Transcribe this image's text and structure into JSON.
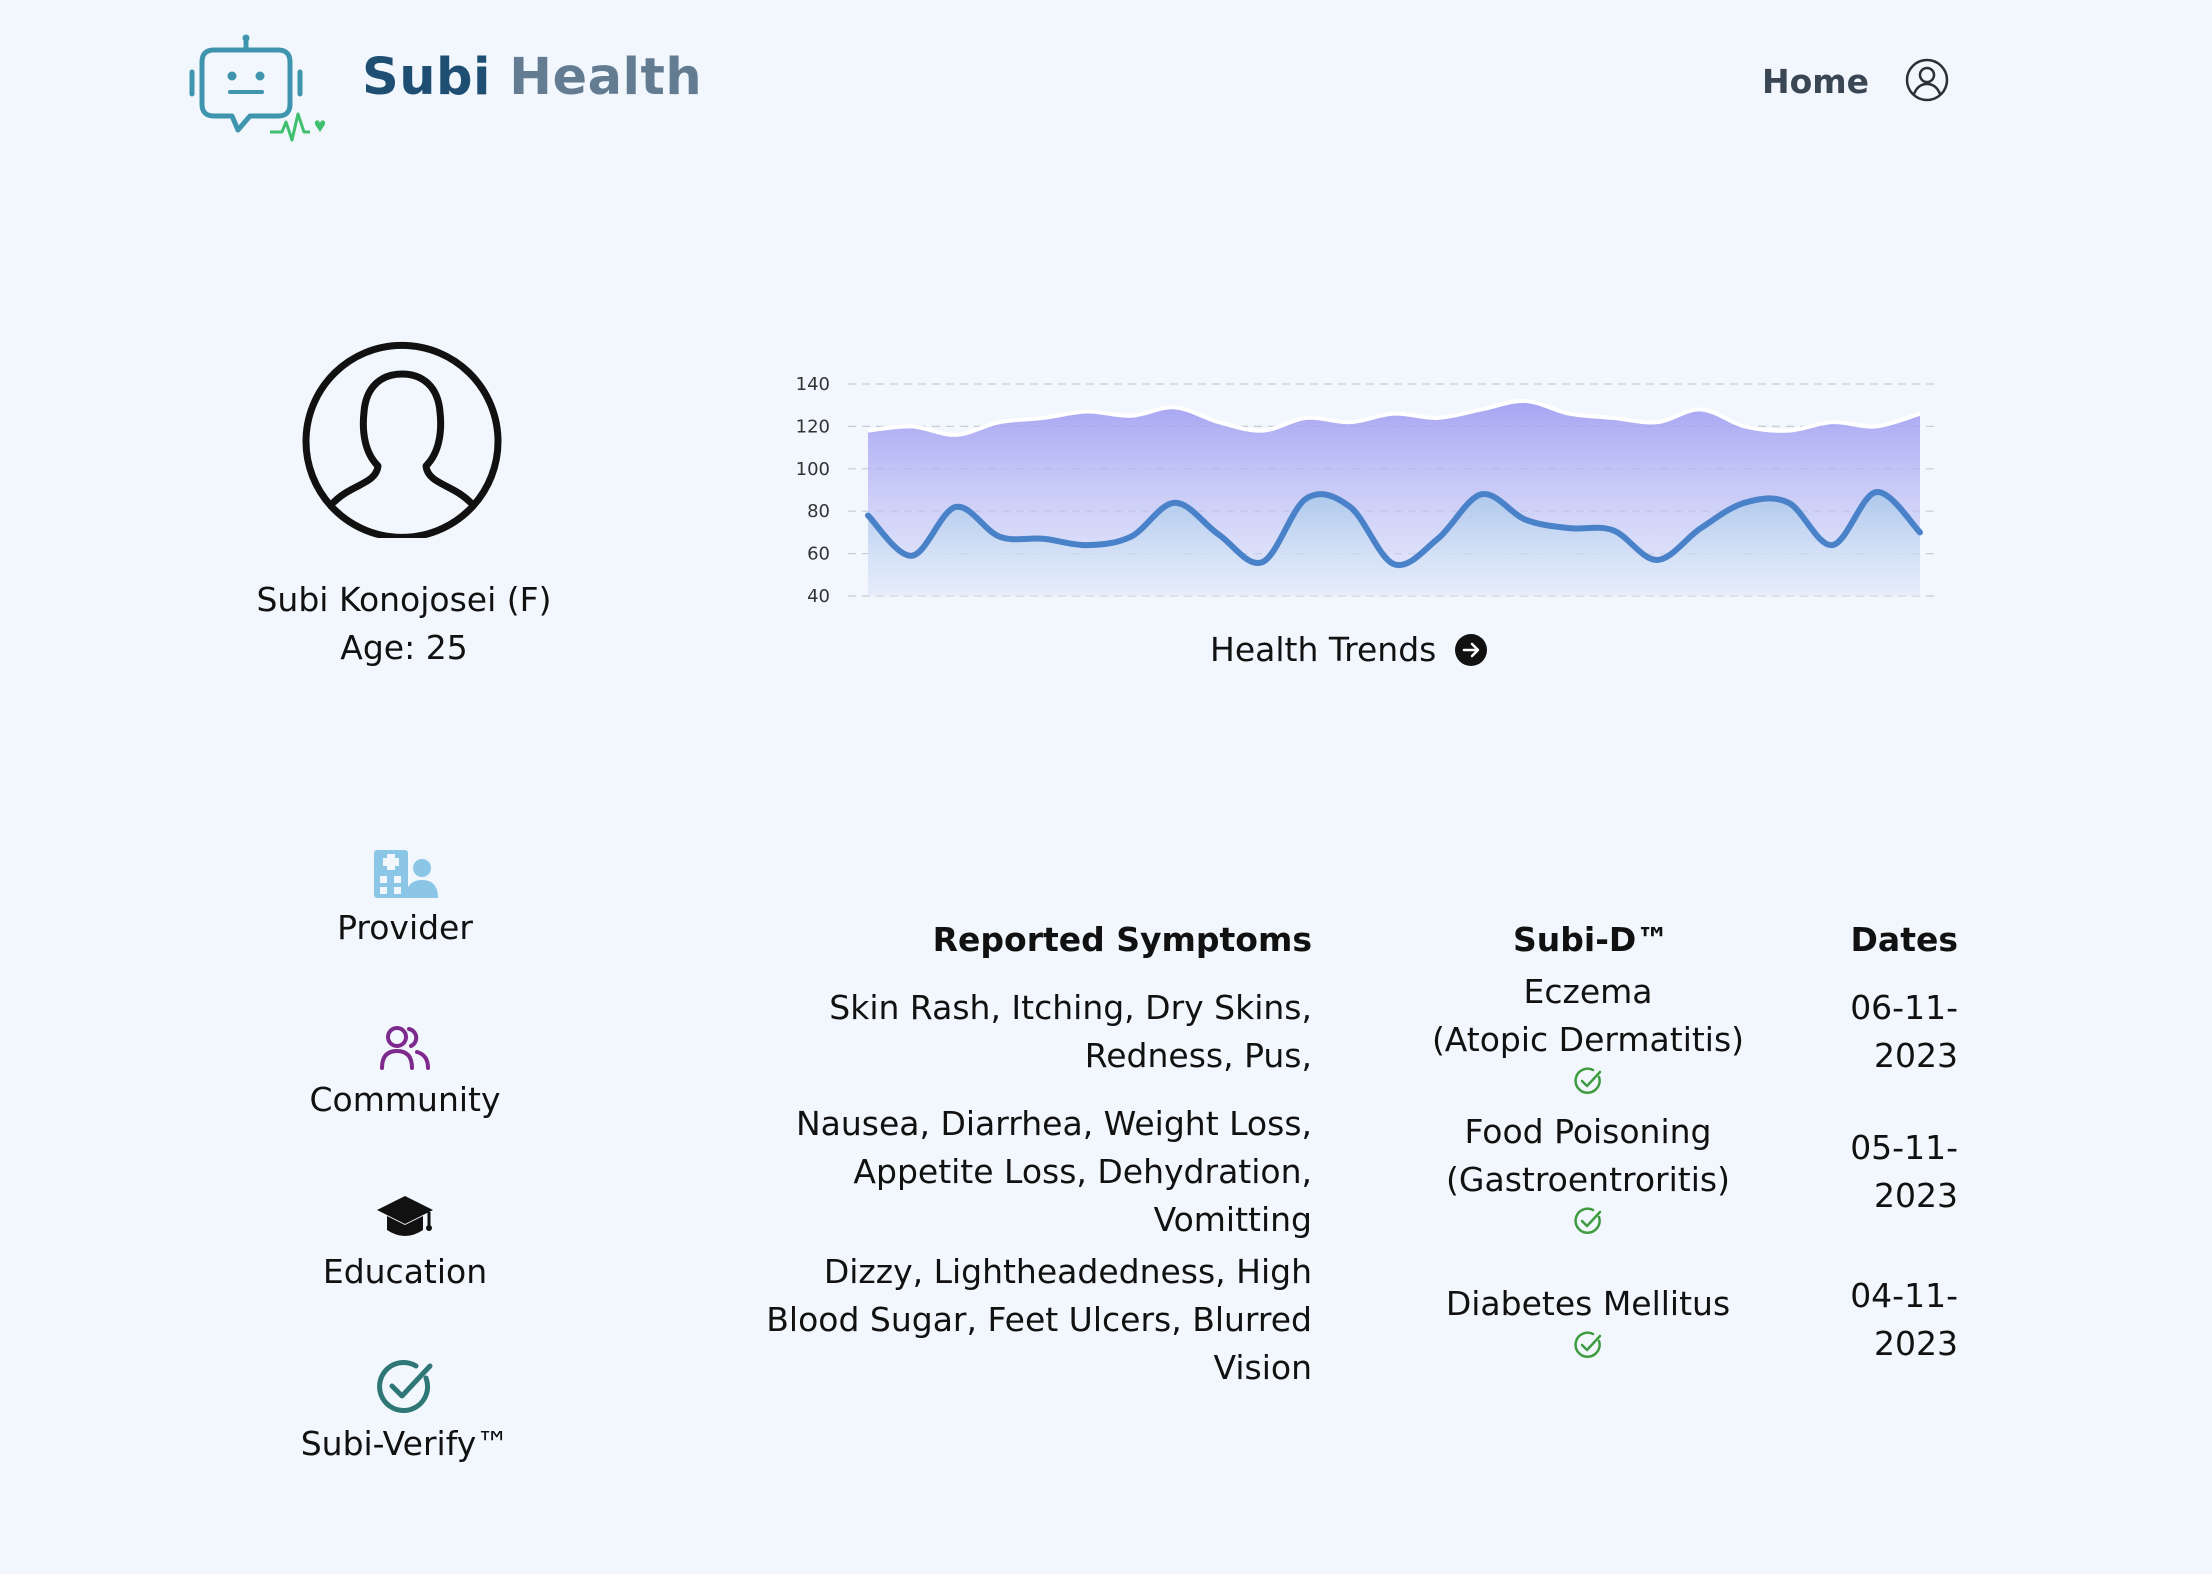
{
  "header": {
    "brand_part1": "Subi",
    "brand_part2": "Health",
    "nav_home": "Home",
    "logo_icon": "robot-chat-heart-icon",
    "user_icon": "user-circle-icon"
  },
  "profile": {
    "name": "Subi Konojosei (F)",
    "age": "Age: 25",
    "avatar_icon": "user-avatar-icon"
  },
  "chart_data": {
    "type": "area",
    "title": "",
    "xlabel": "",
    "ylabel": "",
    "ylim": [
      40,
      140
    ],
    "yticks": [
      140,
      120,
      100,
      80,
      60,
      40
    ],
    "grid": true,
    "series": [
      {
        "values": [
          118,
          120,
          116,
          122,
          124,
          127,
          125,
          129,
          122,
          118,
          124,
          122,
          126,
          124,
          128,
          132,
          126,
          124,
          122,
          128,
          120,
          118,
          122,
          120,
          126
        ],
        "color": "#a8a6f3"
      },
      {
        "values": [
          78,
          59,
          82,
          68,
          67,
          64,
          68,
          84,
          69,
          56,
          86,
          82,
          55,
          67,
          88,
          76,
          72,
          71,
          57,
          72,
          84,
          84,
          64,
          89,
          70
        ],
        "color": "#4a82c9"
      }
    ]
  },
  "trends": {
    "label": "Health Trends",
    "icon": "arrow-right-circle-icon"
  },
  "sidenav": [
    {
      "label": "Provider",
      "icon": "hospital-provider-icon"
    },
    {
      "label": "Community",
      "icon": "community-users-icon"
    },
    {
      "label": "Education",
      "icon": "graduation-cap-icon"
    },
    {
      "label": "Subi-Verify™",
      "icon": "check-circle-icon"
    }
  ],
  "table": {
    "headers": {
      "symptoms": "Reported Symptoms",
      "subid": "Subi-D™",
      "dates": "Dates"
    },
    "rows": [
      {
        "symptoms_l1": "Skin Rash, Itching, Dry Skins,",
        "symptoms_l2": "Redness, Pus,",
        "diag_l1": "Eczema",
        "diag_l2": "(Atopic Dermatitis)",
        "date_l1": "06-11-",
        "date_l2": "2023"
      },
      {
        "symptoms_l1": "Nausea, Diarrhea, Weight Loss,",
        "symptoms_l2": "Appetite Loss, Dehydration,",
        "symptoms_l3": "Vomitting",
        "diag_l1": "Food Poisoning",
        "diag_l2": "(Gastroentroritis)",
        "date_l1": "05-11-",
        "date_l2": "2023"
      },
      {
        "symptoms_l1": "Dizzy, Lightheadedness, High",
        "symptoms_l2": "Blood Sugar, Feet Ulcers, Blurred",
        "symptoms_l3": "Vision",
        "diag_l1": "Diabetes Mellitus",
        "date_l1": "04-11-",
        "date_l2": "2023"
      }
    ],
    "verified_icon": "check-circle-icon",
    "verified_color": "#3f9b3f"
  },
  "colors": {
    "background": "#f1f7fd",
    "brand_dark": "#1e4f73",
    "brand_light": "#647c92",
    "logo_teal": "#3f95ad",
    "logo_green": "#3fbf6f",
    "provider_icon": "#8cc6e6",
    "community_icon": "#7d2a8c",
    "verify_icon": "#2f7777"
  }
}
